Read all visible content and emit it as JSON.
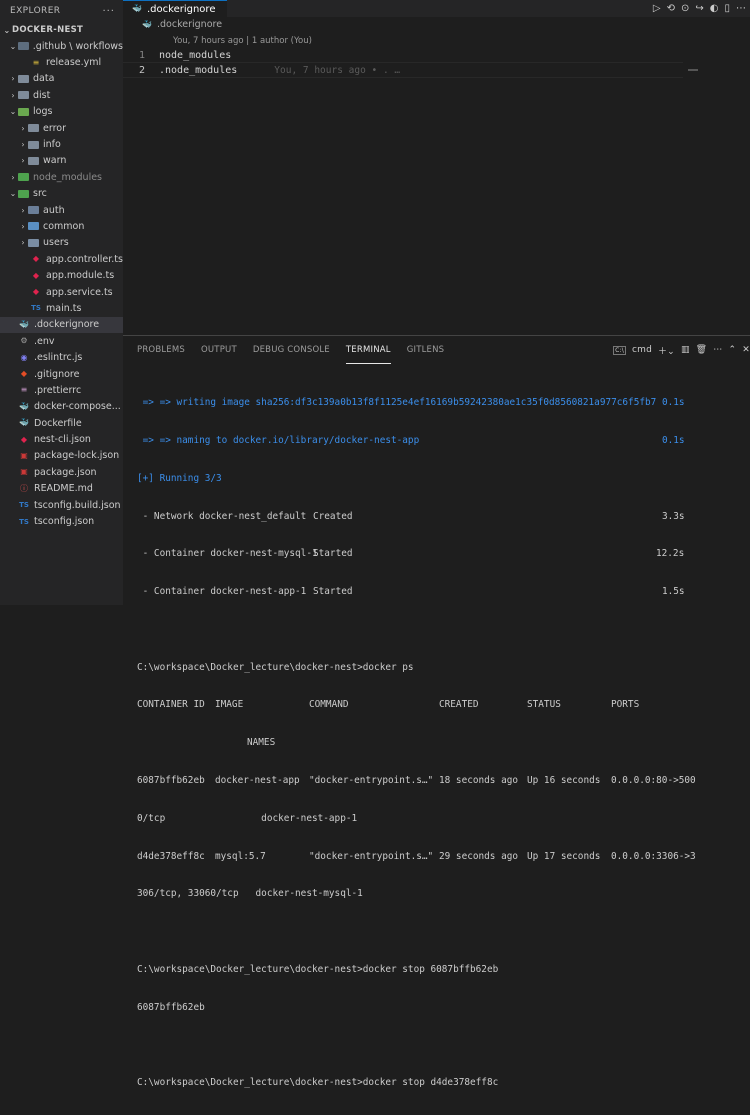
{
  "sidebar": {
    "title": "EXPLORER",
    "more": "···",
    "project": "DOCKER-NEST",
    "items": [
      {
        "label": ".github \\ workflows",
        "depth": 1,
        "kind": "folder-open",
        "icon": "folder-github-icon"
      },
      {
        "label": "release.yml",
        "depth": 2,
        "kind": "file",
        "icon": "yml-file-icon"
      },
      {
        "label": "data",
        "depth": 1,
        "kind": "folder",
        "icon": "folder-icon"
      },
      {
        "label": "dist",
        "depth": 1,
        "kind": "folder",
        "icon": "folder-icon"
      },
      {
        "label": "logs",
        "depth": 1,
        "kind": "folder-open",
        "icon": "folder-logs-icon"
      },
      {
        "label": "error",
        "depth": 2,
        "kind": "folder",
        "icon": "folder-icon"
      },
      {
        "label": "info",
        "depth": 2,
        "kind": "folder",
        "icon": "folder-icon"
      },
      {
        "label": "warn",
        "depth": 2,
        "kind": "folder",
        "icon": "folder-icon"
      },
      {
        "label": "node_modules",
        "depth": 1,
        "kind": "folder",
        "icon": "folder-node-icon"
      },
      {
        "label": "src",
        "depth": 1,
        "kind": "folder-open",
        "icon": "folder-src-icon"
      },
      {
        "label": "auth",
        "depth": 2,
        "kind": "folder",
        "icon": "folder-icon"
      },
      {
        "label": "common",
        "depth": 2,
        "kind": "folder",
        "icon": "folder-icon"
      },
      {
        "label": "users",
        "depth": 2,
        "kind": "folder",
        "icon": "folder-icon"
      },
      {
        "label": "app.controller.ts",
        "depth": 2,
        "kind": "file",
        "icon": "nest-file-icon"
      },
      {
        "label": "app.module.ts",
        "depth": 2,
        "kind": "file",
        "icon": "nest-file-icon"
      },
      {
        "label": "app.service.ts",
        "depth": 2,
        "kind": "file",
        "icon": "nest-file-icon"
      },
      {
        "label": "main.ts",
        "depth": 2,
        "kind": "file",
        "icon": "ts-file-icon"
      },
      {
        "label": ".dockerignore",
        "depth": 1,
        "kind": "file",
        "icon": "docker-file-icon",
        "selected": true
      },
      {
        "label": ".env",
        "depth": 1,
        "kind": "file",
        "icon": "gear-icon"
      },
      {
        "label": ".eslintrc.js",
        "depth": 1,
        "kind": "file",
        "icon": "eslint-icon"
      },
      {
        "label": ".gitignore",
        "depth": 1,
        "kind": "file",
        "icon": "git-icon"
      },
      {
        "label": ".prettierrc",
        "depth": 1,
        "kind": "file",
        "icon": "prettier-icon"
      },
      {
        "label": "docker-compose...",
        "depth": 1,
        "kind": "file",
        "icon": "docker-file-icon"
      },
      {
        "label": "Dockerfile",
        "depth": 1,
        "kind": "file",
        "icon": "docker-file-icon"
      },
      {
        "label": "nest-cli.json",
        "depth": 1,
        "kind": "file",
        "icon": "nest-file-icon"
      },
      {
        "label": "package-lock.json",
        "depth": 1,
        "kind": "file",
        "icon": "npm-icon"
      },
      {
        "label": "package.json",
        "depth": 1,
        "kind": "file",
        "icon": "npm-icon"
      },
      {
        "label": "README.md",
        "depth": 1,
        "kind": "file",
        "icon": "markdown-icon"
      },
      {
        "label": "tsconfig.build.json",
        "depth": 1,
        "kind": "file",
        "icon": "ts-file-icon"
      },
      {
        "label": "tsconfig.json",
        "depth": 1,
        "kind": "file",
        "icon": "ts-file-icon"
      }
    ]
  },
  "editor": {
    "tab_label": ".dockerignore",
    "breadcrumb": ".dockerignore",
    "codelens": "You, 7 hours ago | 1 author (You)",
    "lines": [
      {
        "num": "1",
        "text": "node_modules"
      },
      {
        "num": "2",
        "text": ".node_modules"
      }
    ],
    "blame": "You, 7 hours ago • . …"
  },
  "panel": {
    "tabs": [
      "PROBLEMS",
      "OUTPUT",
      "DEBUG CONSOLE",
      "TERMINAL",
      "GITLENS"
    ],
    "active_tab": "TERMINAL",
    "shell": "cmd",
    "terminal": {
      "build_lines": [
        {
          "text": " => => writing image sha256:df3c139a0b13f8f1125e4ef16169b59242380ae1c35f0d8560821a977c6f5fb7",
          "time": "0.1s"
        },
        {
          "text": " => => naming to docker.io/library/docker-nest-app",
          "time": "0.1s"
        }
      ],
      "running": "[+] Running 3/3",
      "status_lines": [
        {
          "name": " - Network docker-nest_default",
          "state": "Created",
          "time": "3.3s"
        },
        {
          "name": " - Container docker-nest-mysql-1",
          "state": "Started",
          "time": "12.2s"
        },
        {
          "name": " - Container docker-nest-app-1",
          "state": "Started",
          "time": "1.5s"
        }
      ],
      "prompt1": "C:\\workspace\\Docker_lecture\\docker-nest>docker ps",
      "ps_header": {
        "container_id": "CONTAINER ID",
        "image": "IMAGE",
        "command": "COMMAND",
        "created": "CREATED",
        "status": "STATUS",
        "ports": "PORTS"
      },
      "ps_header_names": "NAMES",
      "containers": [
        {
          "id": "6087bffb62eb",
          "image": "docker-nest-app",
          "command": "\"docker-entrypoint.s…\"",
          "created": "18 seconds ago",
          "status": "Up 16 seconds",
          "ports": "0.0.0.0:80->500",
          "wrap": "0/tcp                 docker-nest-app-1"
        },
        {
          "id": "d4de378eff8c",
          "image": "mysql:5.7",
          "command": "\"docker-entrypoint.s…\"",
          "created": "29 seconds ago",
          "status": "Up 17 seconds",
          "ports": "0.0.0.0:3306->3",
          "wrap": "306/tcp, 33060/tcp   docker-nest-mysql-1"
        }
      ],
      "prompt2": "C:\\workspace\\Docker_lecture\\docker-nest>docker stop 6087bffb62eb",
      "stop_output": "6087bffb62eb",
      "prompt3": "C:\\workspace\\Docker_lecture\\docker-nest>docker stop d4de378eff8c"
    }
  }
}
